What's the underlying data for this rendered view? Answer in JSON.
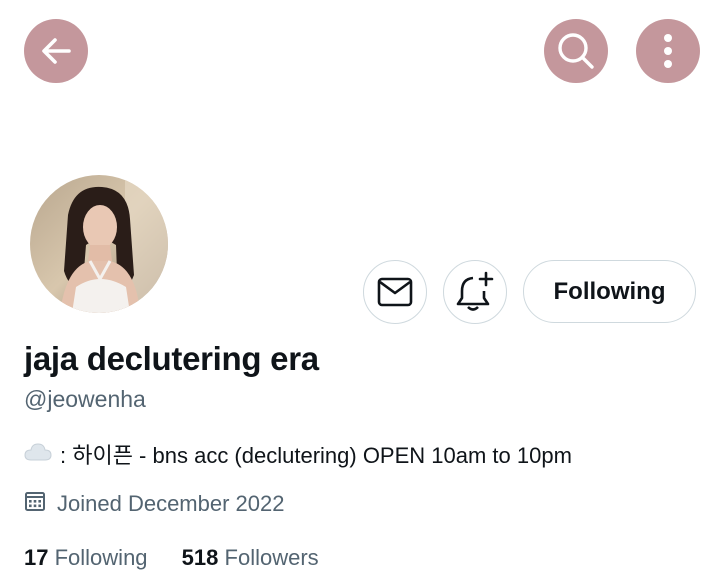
{
  "header": {
    "back_icon": "arrow-left-icon",
    "search_icon": "search-icon",
    "more_icon": "more-vertical-icon",
    "button_color": "#c4979c"
  },
  "profile_actions": {
    "dm_icon": "envelope-icon",
    "notify_icon": "bell-plus-icon",
    "follow_label": "Following"
  },
  "profile": {
    "display_name": "jaja declutering era",
    "handle": "@jeowenha",
    "bio_emoji": "cloud-icon",
    "bio_text": ": 하이픈 - bns acc (declutering) OPEN 10am to 10pm",
    "joined_icon": "calendar-icon",
    "joined": "Joined December 2022"
  },
  "stats": {
    "following_count": "17",
    "following_label": "Following",
    "followers_count": "518",
    "followers_label": "Followers"
  }
}
